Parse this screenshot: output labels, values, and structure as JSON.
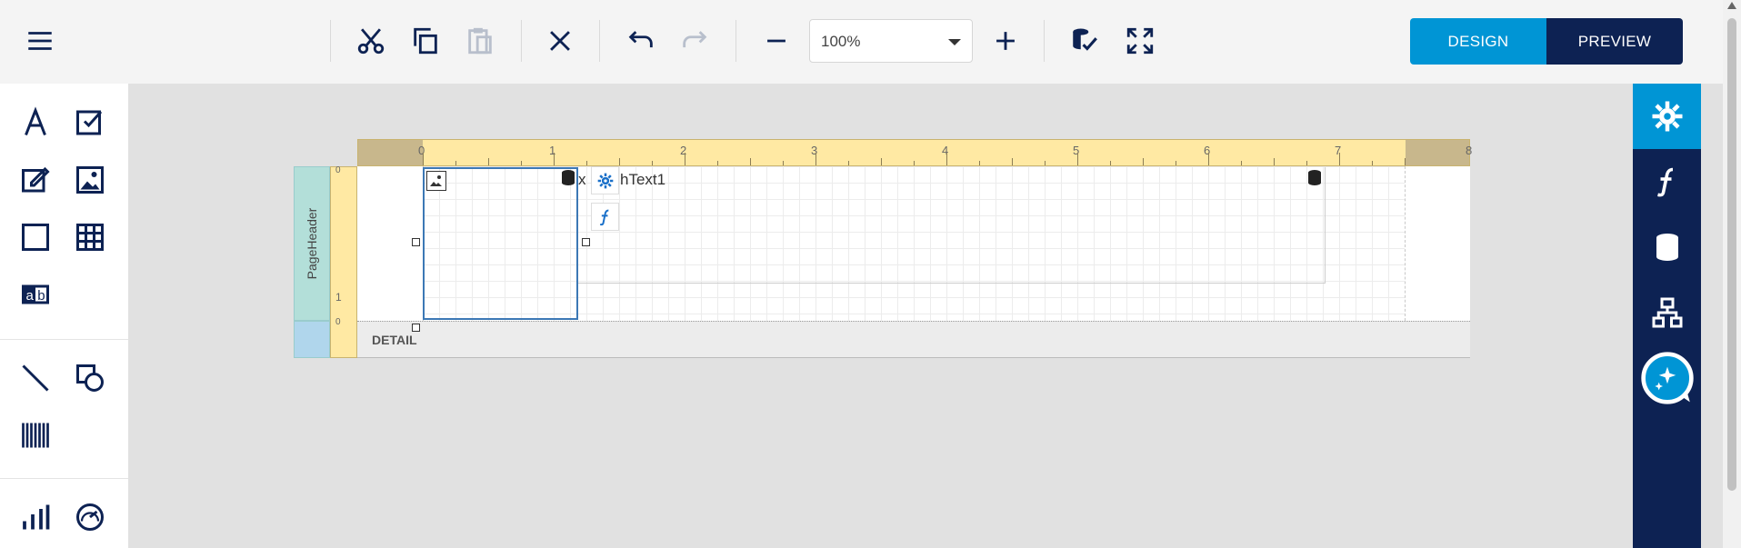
{
  "toolbar": {
    "zoom_value": "100%",
    "design_label": "DESIGN",
    "preview_label": "PREVIEW",
    "buttons": [
      "menu-icon",
      "cut-icon",
      "copy-icon",
      "paste-icon",
      "delete-icon",
      "undo-icon",
      "redo-icon",
      "zoom-out-icon",
      "zoom-in-icon",
      "validate-icon",
      "fullscreen-icon"
    ]
  },
  "colors": {
    "accent": "#0095d5",
    "navy": "#0d2253",
    "icon": "#0d2253"
  },
  "left_panel": {
    "tools": [
      "text-icon",
      "checkbox-icon",
      "richtext-icon",
      "image-icon",
      "shape-icon",
      "table-icon",
      "label-icon",
      "line-icon",
      "shape2-icon",
      "barcode-icon",
      "chart-icon",
      "gauge-icon"
    ]
  },
  "right_panel": {
    "items": [
      "settings-icon",
      "function-icon",
      "datasource-icon",
      "structure-icon",
      "ai-assistant-icon"
    ]
  },
  "report": {
    "ruler_labels": [
      "0",
      "1",
      "2",
      "3",
      "4",
      "5",
      "6",
      "7",
      "8"
    ],
    "ruler_left_labels": [
      "0",
      "1",
      "0"
    ],
    "page_header_label": "PageHeader",
    "detail_label": "DETAIL",
    "text_control_name": "hText1",
    "text_control_prefix": "x"
  }
}
